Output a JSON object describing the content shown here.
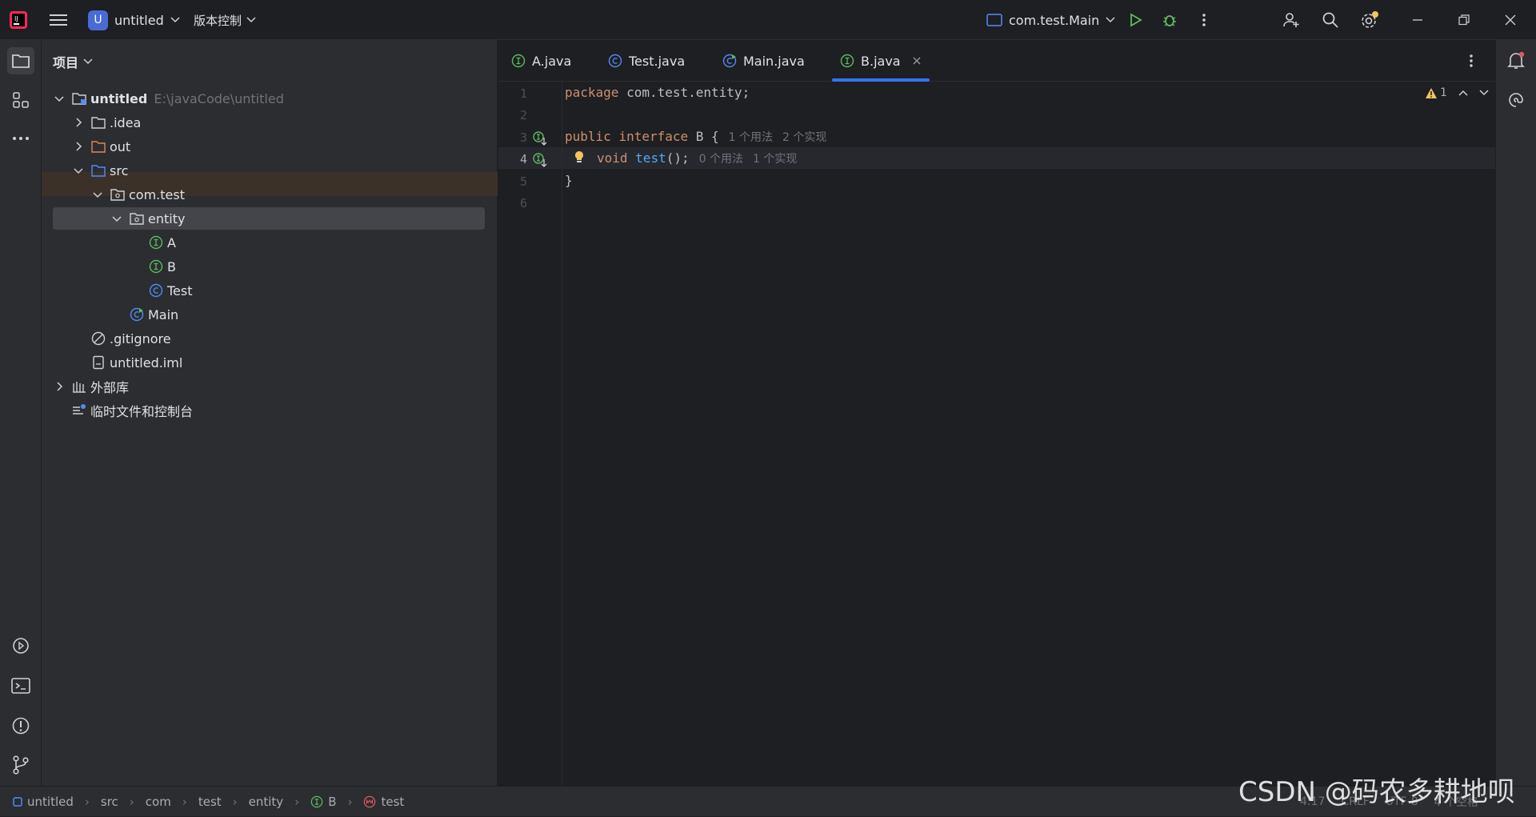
{
  "titlebar": {
    "app_icon": "intellij-logo-icon",
    "project_badge": "U",
    "project_name": "untitled",
    "vcs_label": "版本控制",
    "run_config": "com.test.Main"
  },
  "project_panel": {
    "title": "项目",
    "tree": [
      {
        "label": "untitled",
        "path": "E:\\javaCode\\untitled",
        "icon": "module-folder-icon"
      },
      {
        "label": ".idea",
        "icon": "folder-icon"
      },
      {
        "label": "out",
        "icon": "excluded-folder-icon"
      },
      {
        "label": "src",
        "icon": "source-folder-icon"
      },
      {
        "label": "com.test",
        "icon": "package-icon"
      },
      {
        "label": "entity",
        "icon": "package-icon"
      },
      {
        "label": "A",
        "icon": "interface-icon"
      },
      {
        "label": "B",
        "icon": "interface-icon"
      },
      {
        "label": "Test",
        "icon": "class-icon"
      },
      {
        "label": "Main",
        "icon": "runnable-class-icon"
      },
      {
        "label": ".gitignore",
        "icon": "ignored-file-icon"
      },
      {
        "label": "untitled.iml",
        "icon": "module-file-icon"
      },
      {
        "label": "外部库",
        "icon": "library-icon"
      },
      {
        "label": "临时文件和控制台",
        "icon": "scratches-icon"
      }
    ]
  },
  "editor": {
    "tabs": [
      {
        "label": "A.java",
        "icon": "interface-icon"
      },
      {
        "label": "Test.java",
        "icon": "class-icon"
      },
      {
        "label": "Main.java",
        "icon": "runnable-class-icon"
      },
      {
        "label": "B.java",
        "icon": "interface-icon",
        "active": true
      }
    ],
    "line_numbers": [
      "1",
      "2",
      "3",
      "4",
      "5",
      "6"
    ],
    "code": {
      "l1_kw": "package",
      "l1_rest": " com.test.entity;",
      "l3_kw1": "public",
      "l3_kw2": "interface",
      "l3_rest": " B {",
      "l3_hint1": "1 个用法",
      "l3_hint2": "2 个实现",
      "l4_kw": "void",
      "l4_fn": "test",
      "l4_rest": "();",
      "l4_hint1": "0 个用法",
      "l4_hint2": "1 个实现",
      "l5": "}"
    },
    "warning_count": "1"
  },
  "statusbar": {
    "breadcrumbs": [
      "untitled",
      "src",
      "com",
      "test",
      "entity",
      "B",
      "test"
    ],
    "position": "4:17",
    "line_sep": "CRLF",
    "encoding": "UTF-8",
    "indent": "4 个空格"
  },
  "watermark": "CSDN @码农多耕地呗",
  "colors": {
    "accent": "#3574f0",
    "interface": "#5fb865",
    "class": "#548af7",
    "keyword": "#cf8e6d",
    "function": "#56a8f5"
  }
}
